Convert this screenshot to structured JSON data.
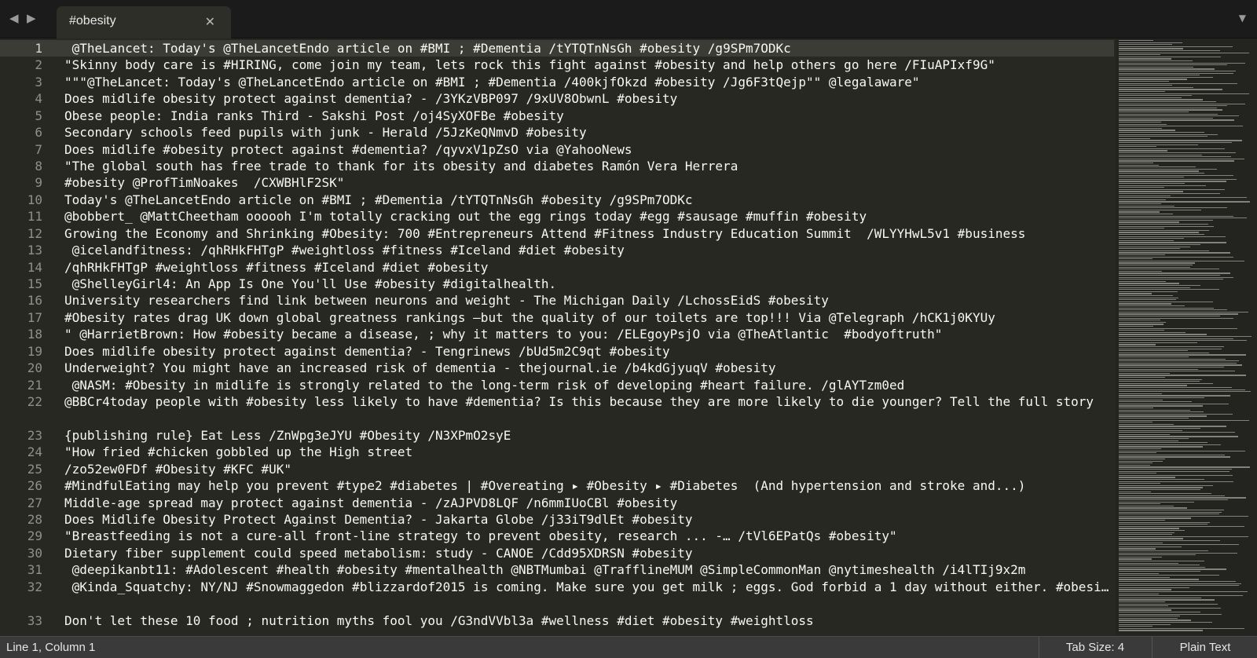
{
  "tab": {
    "title": "#obesity"
  },
  "status": {
    "position": "Line 1, Column 1",
    "tab_size": "Tab Size: 4",
    "syntax": "Plain Text"
  },
  "lines": [
    {
      "n": "1",
      "text": " @TheLancet: Today's @TheLancetEndo article on #BMI ; #Dementia /tYTQTnNsGh #obesity /g9SPm7ODKc"
    },
    {
      "n": "2",
      "text": "\"Skinny body care is #HIRING, come join my team, lets rock this fight against #obesity and help others go here /FIuAPIxf9G\""
    },
    {
      "n": "3",
      "text": "\"\"\"@TheLancet: Today's @TheLancetEndo article on #BMI ; #Dementia /400kjfOkzd #obesity /Jg6F3tQejp\"\" @legalaware\""
    },
    {
      "n": "4",
      "text": "Does midlife obesity protect against dementia? - /3YKzVBP097 /9xUV8ObwnL #obesity"
    },
    {
      "n": "5",
      "text": "Obese people: India ranks Third - Sakshi Post /oj4SyXOFBe #obesity"
    },
    {
      "n": "6",
      "text": "Secondary schools feed pupils with junk - Herald /5JzKeQNmvD #obesity"
    },
    {
      "n": "7",
      "text": "Does midlife #obesity protect against #dementia? /qyvxV1pZsO via @YahooNews"
    },
    {
      "n": "8",
      "text": "\"The global south has free trade to thank for its obesity and diabetes Ramón Vera Herrera"
    },
    {
      "n": "9",
      "text": "#obesity @ProfTimNoakes  /CXWBHlF2SK\""
    },
    {
      "n": "10",
      "text": "Today's @TheLancetEndo article on #BMI ; #Dementia /tYTQTnNsGh #obesity /g9SPm7ODKc"
    },
    {
      "n": "11",
      "text": "@bobbert_ @MattCheetham oooooh I'm totally cracking out the egg rings today #egg #sausage #muffin #obesity"
    },
    {
      "n": "12",
      "text": "Growing the Economy and Shrinking #Obesity: 700 #Entrepreneurs Attend #Fitness Industry Education Summit  /WLYYHwL5v1 #business"
    },
    {
      "n": "13",
      "text": " @icelandfitness: /qhRHkFHTgP #weightloss #fitness #Iceland #diet #obesity"
    },
    {
      "n": "14",
      "text": "/qhRHkFHTgP #weightloss #fitness #Iceland #diet #obesity"
    },
    {
      "n": "15",
      "text": " @ShelleyGirl4: An App Is One You'll Use #obesity #digitalhealth."
    },
    {
      "n": "16",
      "text": "University researchers find link between neurons and weight - The Michigan Daily /LchossEidS #obesity"
    },
    {
      "n": "17",
      "text": "#Obesity rates drag UK down global greatness rankings —but the quality of our toilets are top!!! Via @Telegraph /hCK1j0KYUy"
    },
    {
      "n": "18",
      "text": "\" @HarrietBrown: How #obesity became a disease, ; why it matters to you: /ELEgoyPsjO via @TheAtlantic  #bodyoftruth\""
    },
    {
      "n": "19",
      "text": "Does midlife obesity protect against dementia? - Tengrinews /bUd5m2C9qt #obesity"
    },
    {
      "n": "20",
      "text": "Underweight? You might have an increased risk of dementia - thejournal.ie /b4kdGjyuqV #obesity"
    },
    {
      "n": "21",
      "text": " @NASM: #Obesity in midlife is strongly related to the long-term risk of developing #heart failure. /glAYTzm0ed"
    },
    {
      "n": "22",
      "text": "@BBCr4today people with #obesity less likely to have #dementia? Is this because they are more likely to die younger? Tell the full story"
    },
    {
      "n": "23",
      "text": "{publishing rule} Eat Less /ZnWpg3eJYU #Obesity /N3XPmO2syE"
    },
    {
      "n": "24",
      "text": "\"How fried #chicken gobbled up the High street"
    },
    {
      "n": "25",
      "text": "/zo52ew0FDf #Obesity #KFC #UK\""
    },
    {
      "n": "26",
      "text": "#MindfulEating may help you prevent #type2 #diabetes | #Overeating ▸ #Obesity ▸ #Diabetes  (And hypertension and stroke and...)"
    },
    {
      "n": "27",
      "text": "Middle-age spread may protect against dementia - /zAJPVD8LQF /n6mmIUoCBl #obesity"
    },
    {
      "n": "28",
      "text": "Does Midlife Obesity Protect Against Dementia? - Jakarta Globe /j33iT9dlEt #obesity"
    },
    {
      "n": "29",
      "text": "\"Breastfeeding is not a cure-all front-line strategy to prevent obesity, research ... -… /tVl6EPatQs #obesity\""
    },
    {
      "n": "30",
      "text": "Dietary fiber supplement could speed metabolism: study - CANOE /Cdd95XDRSN #obesity"
    },
    {
      "n": "31",
      "text": " @deepikanbt11: #Adolescent #health #obesity #mentalhealth @NBTMumbai @TrafflineMUM @SimpleCommonMan @nytimeshealth /i4lTIj9x2m"
    },
    {
      "n": "32",
      "text": " @Kinda_Squatchy: NY/NJ #Snowmaggedon #blizzardof2015 is coming. Make sure you get milk ; eggs. God forbid a 1 day without either. #obesi…"
    },
    {
      "n": "33",
      "text": "Don't let these 10 food ; nutrition myths fool you /G3ndVVbl3a #wellness #diet #obesity #weightloss"
    }
  ],
  "icons": {
    "back": "left-arrow-icon",
    "forward": "right-arrow-icon",
    "close": "close-icon",
    "menu": "chevron-down-icon"
  },
  "colors": {
    "background": "#272822",
    "text": "#f8f8f2",
    "gutter_text": "#8f908a",
    "tabbar": "#1b1b1b",
    "statusbar": "#3a3a3a"
  }
}
